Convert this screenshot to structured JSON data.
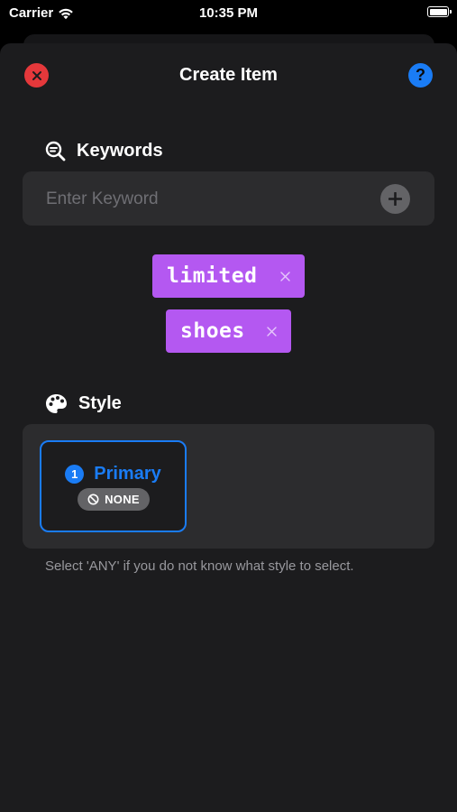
{
  "status_bar": {
    "carrier": "Carrier",
    "time": "10:35 PM",
    "battery_level": 1.0
  },
  "nav": {
    "title": "Create Item",
    "close_icon": "close-icon",
    "help_label": "?"
  },
  "keywords": {
    "title": "Keywords",
    "icon": "magnifying-glass-lines-icon",
    "input": {
      "placeholder": "Enter Keyword",
      "value": ""
    },
    "add_icon": "plus-icon",
    "tags": [
      {
        "label": "limited"
      },
      {
        "label": "shoes"
      }
    ]
  },
  "style": {
    "title": "Style",
    "icon": "palette-icon",
    "cards": [
      {
        "number": "1",
        "name": "Primary",
        "badge": "NONE",
        "selected": true
      }
    ],
    "help_text": "Select 'ANY' if you do not know what style to select."
  },
  "colors": {
    "background": "#000000",
    "sheet": "#1c1c1e",
    "field": "#2c2c2e",
    "accent_blue": "#1a7cf5",
    "close_red": "#e5383b",
    "tag_purple": "#b458f1",
    "muted_gray": "#636366"
  }
}
